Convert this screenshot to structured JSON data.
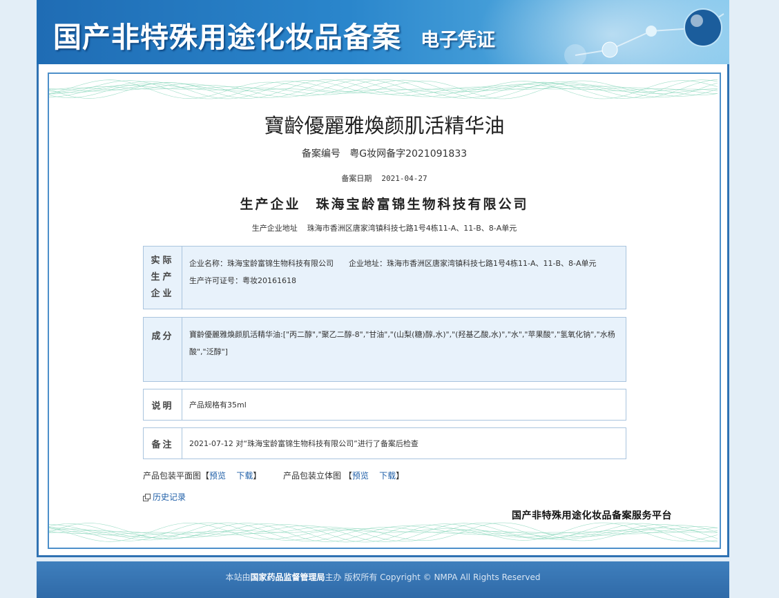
{
  "banner": {
    "title": "国产非特殊用途化妆品备案",
    "subtitle": "电子凭证"
  },
  "certificate": {
    "product_name": "寶齡優麗雅煥颜肌活精华油",
    "reg_label": "备案编号",
    "reg_number": "粤G妆网备字2021091833",
    "date_label": "备案日期",
    "date_value": "2021-04-27",
    "manufacturer_label": "生产企业",
    "manufacturer_value": "珠海宝龄富锦生物科技有限公司",
    "address_label": "生产企业地址",
    "address_value": "珠海市香洲区唐家湾镇科技七路1号4栋11-A、11-B、8-A单元"
  },
  "sections": {
    "actual": {
      "label_lines": [
        "实际",
        "生产",
        "企业"
      ],
      "text": "企业名称：珠海宝龄富锦生物科技有限公司　　企业地址：珠海市香洲区唐家湾镇科技七路1号4栋11-A、11-B、8-A单元　　生产许可证号：粤妆20161618"
    },
    "ingredients": {
      "label": "成分",
      "text": "寶齡優麗雅煥颜肌活精华油:[\"丙二醇\",\"聚乙二醇-8\",\"甘油\",\"(山梨(糖)醇,水)\",\"(羟基乙酸,水)\",\"水\",\"苹果酸\",\"氢氧化钠\",\"水杨酸\",\"泛醇\"]"
    },
    "description": {
      "label": "说明",
      "text": "产品规格有35ml"
    },
    "note": {
      "label": "备注",
      "text": "2021-07-12 对“珠海宝龄富锦生物科技有限公司”进行了备案后检查"
    }
  },
  "packaging": {
    "flat_label": "产品包装平面图",
    "solid_label": "产品包装立体图",
    "bracket_open": "【",
    "bracket_close": "】",
    "preview": "预览",
    "download": "下载"
  },
  "history_link": "历史记录",
  "platform_name": "国产非特殊用途化妆品备案服务平台",
  "footer": {
    "prefix": "本站由",
    "org": "国家药品监督管理局",
    "suffix": "主办 版权所有 Copyright © NMPA All Rights Reserved"
  },
  "colors": {
    "banner": "#2a86cc",
    "frame": "#2f72b3",
    "box_blue": "#e8f2fb",
    "link": "#1f5fa8",
    "guilloche": "#7fd3b6"
  }
}
